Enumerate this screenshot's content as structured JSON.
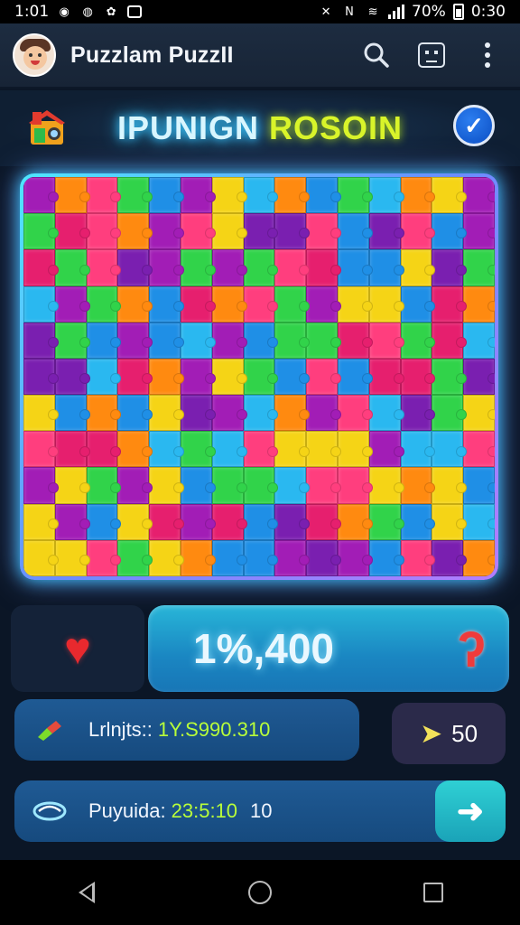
{
  "status_bar": {
    "time": "1:01",
    "battery_text": "70%",
    "clock_right": "0:30"
  },
  "app_bar": {
    "title": "Puzzlam PuzzII",
    "icons": [
      "search-icon",
      "face-icon",
      "more-vert-icon"
    ]
  },
  "heading": {
    "word1": "IPUNIGN",
    "word2": "ROSOIN"
  },
  "board": {
    "rows": 11,
    "cols": 15,
    "palette": [
      "#f5d416",
      "#ff3e7e",
      "#31d34a",
      "#1f8fe6",
      "#a21db6",
      "#ff8a10",
      "#e61f6e",
      "#2ab8f0",
      "#7a1fb0"
    ]
  },
  "score": {
    "value": "1%,400"
  },
  "stats": {
    "row1": {
      "label": "Lrlnjts::",
      "value": "1Y.S990.310"
    },
    "bonus": {
      "value": "50"
    },
    "row2": {
      "label": "Puyuida:",
      "value": "23:5:10",
      "extra": "10"
    }
  },
  "colors": {
    "accent": "#38c6ff",
    "highlight": "#b9ff3a",
    "heart": "#e8292e"
  }
}
